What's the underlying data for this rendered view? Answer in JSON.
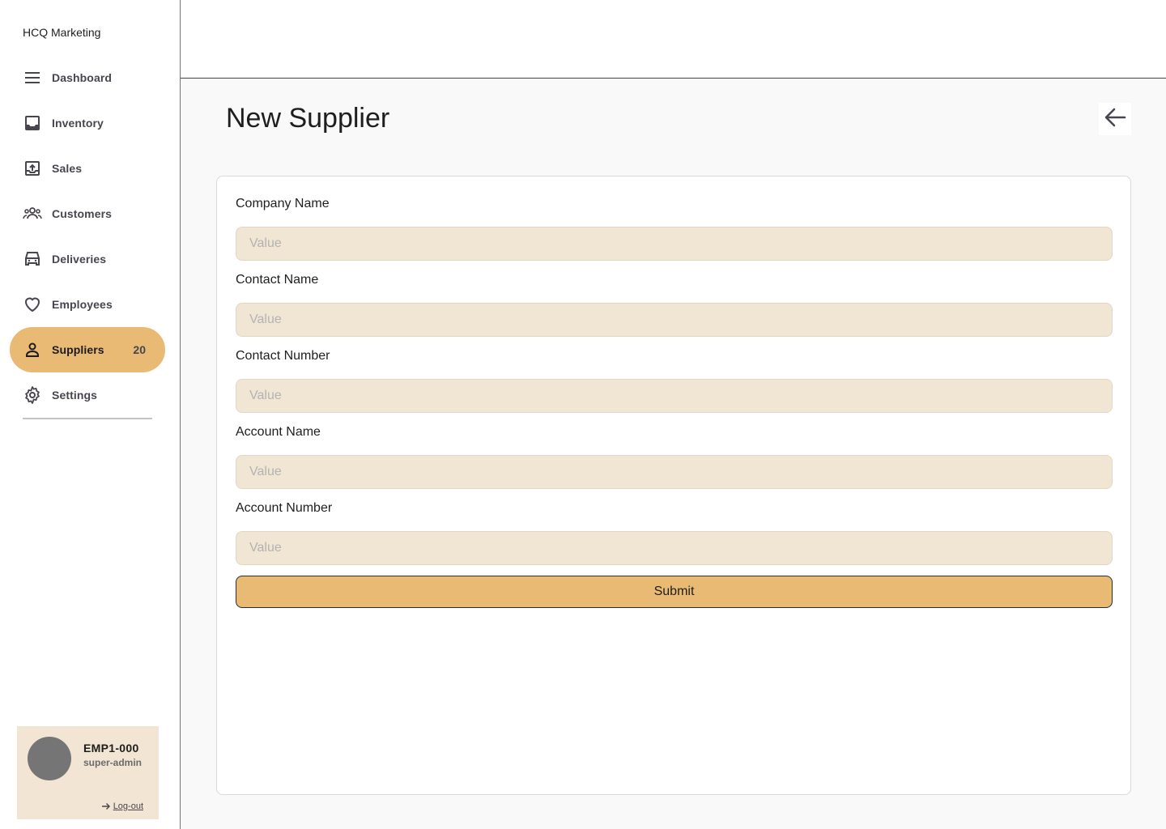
{
  "sidebar": {
    "brand": "HCQ Marketing",
    "items": [
      {
        "label": "Dashboard",
        "icon": "menu-icon"
      },
      {
        "label": "Inventory",
        "icon": "inbox-icon"
      },
      {
        "label": "Sales",
        "icon": "upload-box-icon"
      },
      {
        "label": "Customers",
        "icon": "group-icon"
      },
      {
        "label": "Deliveries",
        "icon": "vehicle-icon"
      },
      {
        "label": "Employees",
        "icon": "heart-icon"
      },
      {
        "label": "Suppliers",
        "icon": "person-icon",
        "badge": "20",
        "active": true
      },
      {
        "label": "Settings",
        "icon": "gear-icon"
      }
    ],
    "user": {
      "id": "EMP1-000",
      "role": "super-admin",
      "logout_label": "Log-out"
    }
  },
  "main": {
    "title": "New Supplier",
    "form": {
      "fields": [
        {
          "label": "Company Name",
          "placeholder": "Value",
          "value": ""
        },
        {
          "label": "Contact Name",
          "placeholder": "Value",
          "value": ""
        },
        {
          "label": "Contact Number",
          "placeholder": "Value",
          "value": ""
        },
        {
          "label": "Account Name",
          "placeholder": "Value",
          "value": ""
        },
        {
          "label": "Account Number",
          "placeholder": "Value",
          "value": ""
        }
      ],
      "submit_label": "Submit"
    }
  },
  "colors": {
    "accent": "#e8ba73",
    "input_bg": "#f1e5d3",
    "user_card_bg": "#f2e5d3",
    "avatar": "#757575"
  }
}
